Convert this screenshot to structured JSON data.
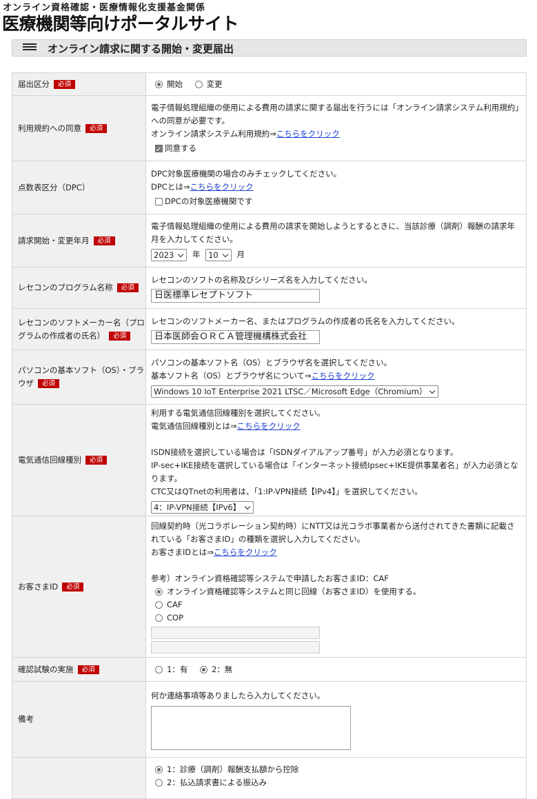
{
  "header": {
    "subtitle": "オンライン資格確認・医療情報化支援基金関係",
    "title": "医療機関等向けポータルサイト"
  },
  "section": {
    "title": "オンライン請求に関する開始・変更届出"
  },
  "required_badge": "必須",
  "rows": {
    "notify_type": {
      "label": "届出区分",
      "options": [
        "開始",
        "変更"
      ],
      "selected": "開始"
    },
    "terms": {
      "label": "利用規約への同意",
      "desc": "電子情報処理組織の使用による費用の請求に関する届出を行うには「オンライン請求システム利用規約」への同意が必要です。",
      "link_prefix": "オンライン請求システム利用規約⇒",
      "link": "こちらをクリック",
      "checkbox": "同意する",
      "checked": true
    },
    "dpc": {
      "label": "点数表区分（DPC）",
      "desc": "DPC対象医療機関の場合のみチェックしてください。",
      "link_prefix": "DPCとは⇒",
      "link": "こちらをクリック",
      "checkbox": "DPCの対象医療機関です",
      "checked": false
    },
    "start_month": {
      "label": "請求開始・変更年月",
      "desc": "電子情報処理組織の使用による費用の請求を開始しようとするときに、当該診療（調剤）報酬の請求年月を入力してください。",
      "year": "2023",
      "year_unit": "年",
      "month": "10",
      "month_unit": "月"
    },
    "program": {
      "label": "レセコンのプログラム名称",
      "desc": "レセコンのソフトの名称及びシリーズ名を入力してください。",
      "value": "日医標準レセプトソフト"
    },
    "maker": {
      "label": "レセコンのソフトメーカー名（プログラムの作成者の氏名）",
      "desc": "レセコンのソフトメーカー名、またはプログラムの作成者の氏名を入力してください。",
      "value": "日本医師会ＯＲＣＡ管理機構株式会社"
    },
    "os": {
      "label": "パソコンの基本ソフト（OS）・ブラウザ",
      "desc": "パソコンの基本ソフト名（OS）とブラウザ名を選択してください。",
      "link_prefix": "基本ソフト名（OS）とブラウザ名について⇒",
      "link": "こちらをクリック",
      "selected": "Windows 10 IoT Enterprise 2021 LTSC／Microsoft Edge（Chromium）"
    },
    "line": {
      "label": "電気通信回線種別",
      "desc": "利用する電気通信回線種別を選択してください。",
      "link_prefix": "電気通信回線種別とは⇒",
      "link": "こちらをクリック",
      "note1": "ISDN接続を選択している場合は「ISDNダイアルアップ番号」が入力必須となります。",
      "note2": "IP-sec+IKE接続を選択している場合は「インターネット接続Ipsec+IKE提供事業者名」が入力必須となります。",
      "note3": "CTC又はQTnetの利用者は、「1:IP-VPN接続【IPv4】」を選択してください。",
      "selected": "4：IP-VPN接続【IPv6】"
    },
    "customer_id": {
      "label": "お客さまID",
      "desc": "回線契約時（光コラボレーション契約時）にNTT又は光コラボ事業者から送付されてきた書類に記載されている「お客さまID」の種類を選択し入力してください。",
      "link_prefix": "お客さまIDとは⇒",
      "link": "こちらをクリック",
      "ref": "参考）オンライン資格確認等システムで申請したお客さまID：CAF",
      "options": [
        "オンライン資格確認等システムと同じ回線（お客さまID）を使用する。",
        "CAF",
        "COP"
      ],
      "selected": "オンライン資格確認等システムと同じ回線（お客さまID）を使用する。"
    },
    "test": {
      "label": "確認試験の実施",
      "options": [
        "1：有",
        "2：無"
      ],
      "selected": "2：無"
    },
    "remarks": {
      "label": "備考",
      "desc": "何か連絡事項等ありましたら入力してください。"
    },
    "payment": {
      "options": [
        "1：診療（調剤）報酬支払額から控除",
        "2：払込請求書による振込み"
      ],
      "selected": "1：診療（調剤）報酬支払額から控除"
    }
  }
}
